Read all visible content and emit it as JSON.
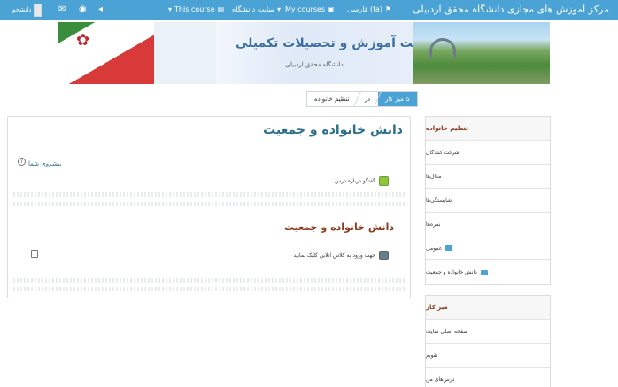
{
  "navbar": {
    "site_title": "مرکز آموزش های مجازی دانشگاه محقق اردبیلی",
    "language": "فارسی (fa)",
    "my_courses": "My courses",
    "university_site": "سایت دانشگاه",
    "this_course": "This course",
    "user_label": "دانشجو",
    "icons": [
      "flag-icon",
      "briefcase-icon",
      "chevron-down-icon",
      "book-icon",
      "envelope-icon",
      "globe-icon"
    ]
  },
  "banner": {
    "title": "معاونت آموزش و تحصیلات تکمیلی",
    "subtitle": "دانشگاه محقق اردبیلی"
  },
  "breadcrumb": {
    "items": [
      "میز کار",
      "در",
      "تنظیم خانواده"
    ]
  },
  "main": {
    "course_title": "دانش خانواده و جمعیت",
    "progress_link": "پیشروی شما",
    "forum_activity": "گفتگو درباره درس",
    "section_title": "دانش خانواده و جمعیت",
    "bbb_activity": "جهت ورود به کلاس آنلاین کلیک نمایید"
  },
  "nav_block": {
    "items": [
      {
        "label": "تنظیم خانواده",
        "type": "header"
      },
      {
        "label": "شرکت کنندگان",
        "type": "item"
      },
      {
        "label": "مدال‌ها",
        "type": "item"
      },
      {
        "label": "شایستگی‌ها",
        "type": "item"
      },
      {
        "label": "نمره‌ها",
        "type": "item"
      },
      {
        "label": "عمومی",
        "type": "folder"
      },
      {
        "label": "دانش خانواده و جمعیت",
        "type": "folder"
      }
    ]
  },
  "nav_block2": {
    "items": [
      {
        "label": "میز کار"
      },
      {
        "label": "صفحه اصلی سایت"
      },
      {
        "label": "تقویم"
      },
      {
        "label": "درس‌های من"
      }
    ]
  },
  "colors": {
    "navbar": "#4aa3d4",
    "course_title": "#2b6f8a",
    "section_title": "#8a3b1e"
  }
}
